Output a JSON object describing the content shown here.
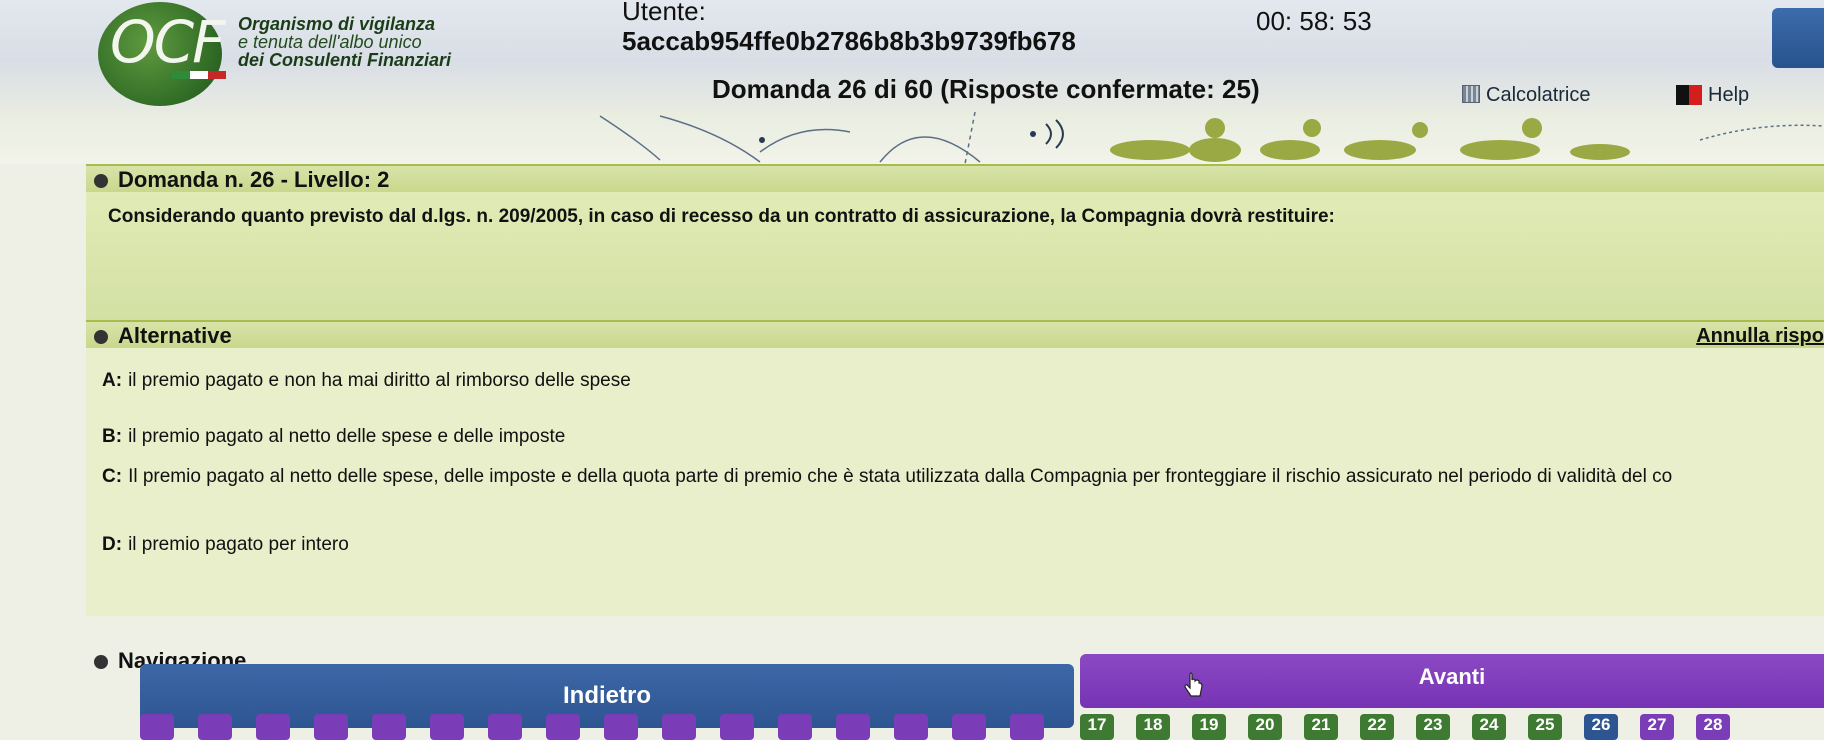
{
  "header": {
    "logo": "OCF",
    "org_lines": [
      "Organismo di vigilanza",
      "e tenuta dell'albo unico",
      "dei Consulenti Finanziari"
    ],
    "utente_label": "Utente:",
    "utente_id": "5accab954ffe0b2786b8b3b9739fb678",
    "domanda_status": "Domanda 26 di 60 (Risposte confermate: 25)",
    "timer": "00: 58: 53",
    "calcolatrice_label": "Calcolatrice",
    "help_label": "Help"
  },
  "question": {
    "title": "Domanda n. 26 - Livello: 2",
    "text": "Considerando quanto previsto dal d.lgs. n. 209/2005, in caso di recesso da un contratto di assicurazione, la Compagnia dovrà restituire:"
  },
  "alternatives": {
    "title": "Alternative",
    "annulla_label": "Annulla rispo",
    "options": [
      {
        "letter": "A:",
        "text": "il premio pagato e non ha mai diritto al rimborso delle spese"
      },
      {
        "letter": "B:",
        "text": "il premio pagato al netto delle spese e delle imposte"
      },
      {
        "letter": "C:",
        "text": "Il premio pagato al netto delle spese, delle imposte e della quota parte di premio che è stata utilizzata dalla Compagnia per fronteggiare il rischio assicurato nel periodo di validità del co"
      },
      {
        "letter": "D:",
        "text": "il premio pagato per intero"
      }
    ]
  },
  "navigation": {
    "title": "Navigazione",
    "back_label": "Indietro",
    "next_label": "Avanti",
    "pages": [
      "17",
      "18",
      "19",
      "20",
      "21",
      "22",
      "23",
      "24",
      "25",
      "26",
      "27",
      "28"
    ]
  },
  "colors": {
    "back_button": "#2d5592",
    "next_button": "#7634b4",
    "section_bar": "#c8d78a"
  }
}
